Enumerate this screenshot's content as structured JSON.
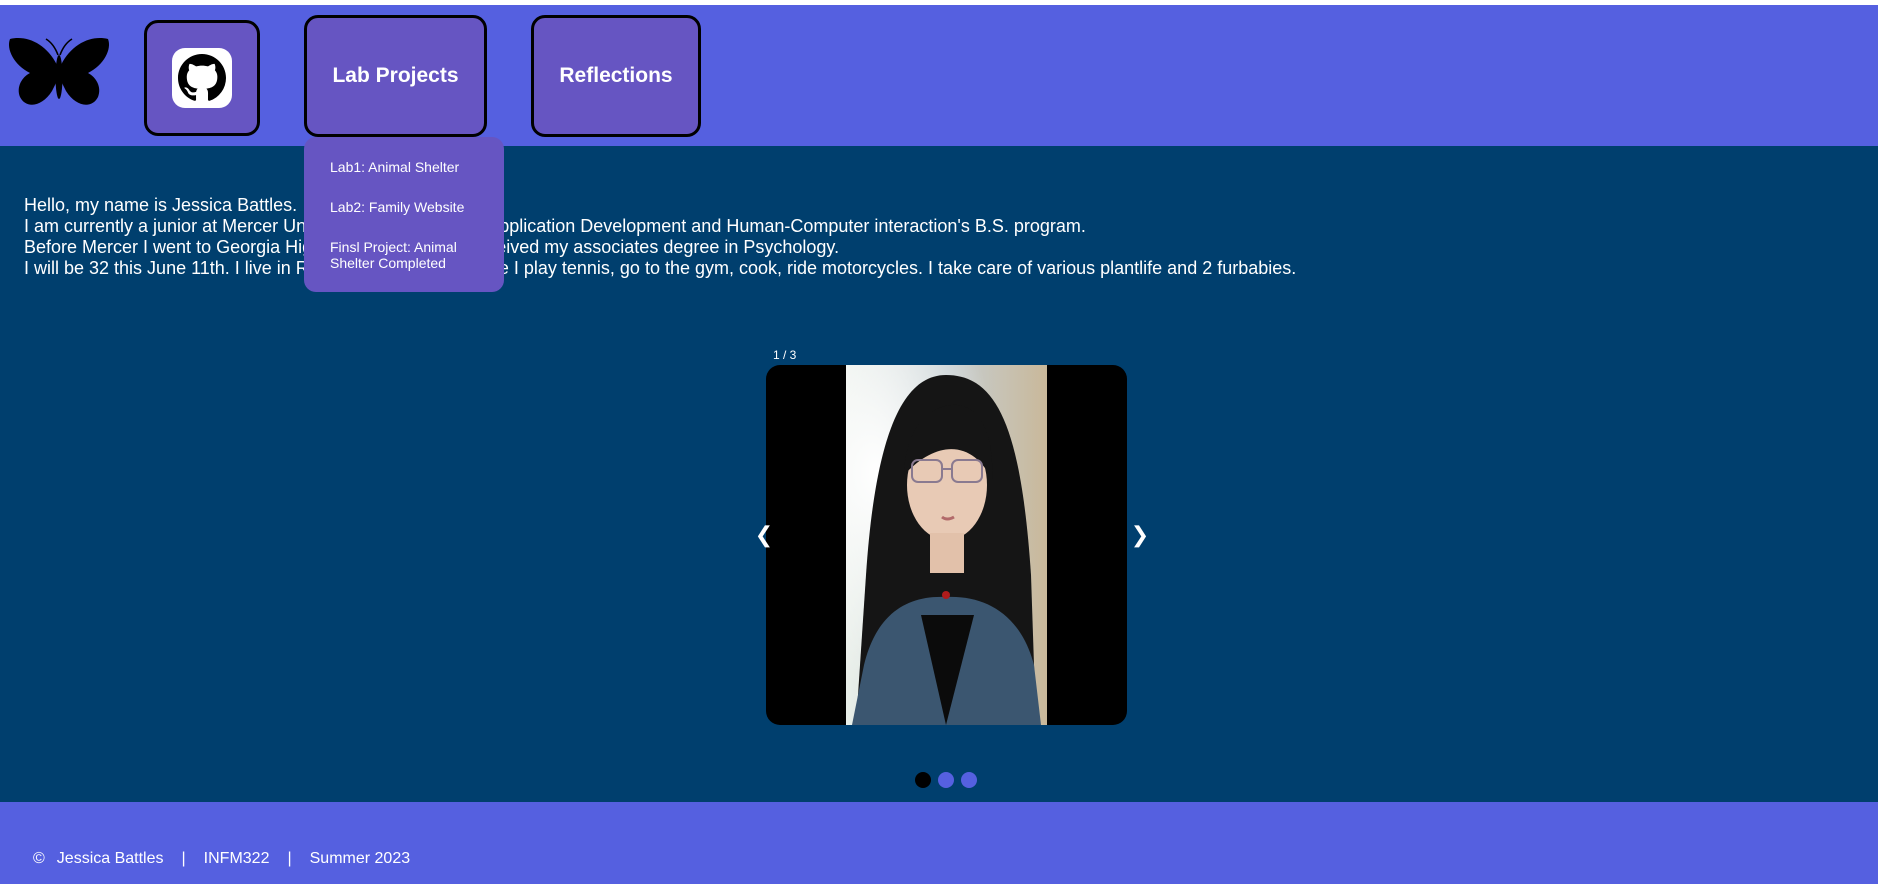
{
  "header": {
    "logo_icon": "butterfly-icon",
    "github_icon": "github-icon",
    "nav": {
      "lab_projects": "Lab Projects",
      "reflections": "Reflections"
    }
  },
  "dropdown": {
    "items": [
      {
        "label": "Lab1: Animal Shelter"
      },
      {
        "label": "Lab2: Family Website"
      },
      {
        "label": "Finsl Project: Animal Shelter Completed"
      }
    ]
  },
  "intro": {
    "lines": [
      "Hello, my name is Jessica Battles.",
      "I am currently a junior at Mercer University studying in the Application Development and Human-Computer interaction's B.S. program.",
      "Before Mercer I went to Georgia Highlands College and received my associates degree in Psychology.",
      "I will be 32 this June 11th. I live in Rome, GA. In my free time I play tennis, go to the gym, cook, ride motorcycles. I take care of various plantlife and 2 furbabies."
    ]
  },
  "slideshow": {
    "counter": "1 / 3",
    "prev_symbol": "❮",
    "next_symbol": "❯",
    "slides_total": 3,
    "active_index": 0
  },
  "footer": {
    "copyright_symbol": "©",
    "name": "Jessica Battles",
    "separator": "|",
    "course": "INFM322",
    "term": "Summer 2023"
  },
  "colors": {
    "header_bg": "#5560e0",
    "main_bg": "#003f6e",
    "nav_box_bg": "#6655c2",
    "dot_active": "#000000",
    "dot_inactive": "#5560e0"
  }
}
